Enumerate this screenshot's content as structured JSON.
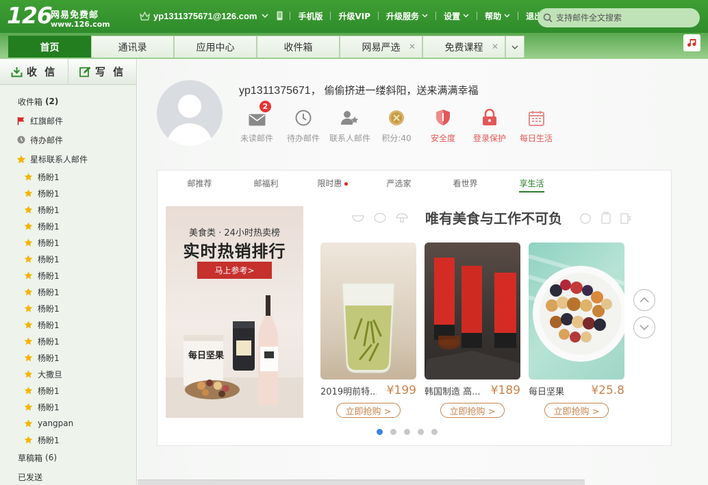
{
  "header": {
    "logo_number": "126",
    "logo_text": "网易免费邮",
    "logo_url": "www.126.com",
    "user_email": "yp1311375671@126.com",
    "nav": [
      "手机版",
      "升级VIP",
      "升级服务",
      "设置",
      "帮助",
      "退出"
    ],
    "search_placeholder": "支持邮件全文搜索"
  },
  "tabs": [
    {
      "label": "首页",
      "active": true,
      "closable": false
    },
    {
      "label": "通讯录",
      "active": false,
      "closable": false
    },
    {
      "label": "应用中心",
      "active": false,
      "closable": false
    },
    {
      "label": "收件箱",
      "active": false,
      "closable": false
    },
    {
      "label": "网易严选",
      "active": false,
      "closable": true
    },
    {
      "label": "免费课程",
      "active": false,
      "closable": true
    }
  ],
  "sidebar": {
    "receive_label": "收 信",
    "write_label": "写 信",
    "inbox": {
      "label": "收件箱",
      "count": "(2)"
    },
    "red_flag": "红旗邮件",
    "todo": "待办邮件",
    "starred": "星标联系人邮件",
    "contacts": [
      "杨盼1",
      "杨盼1",
      "杨盼1",
      "杨盼1",
      "杨盼1",
      "杨盼1",
      "杨盼1",
      "杨盼1",
      "杨盼1",
      "杨盼1",
      "杨盼1",
      "杨盼1",
      "大撒旦",
      "杨盼1",
      "杨盼1",
      "yangpan",
      "杨盼1"
    ],
    "drafts": {
      "label": "草稿箱",
      "count": "(6)"
    },
    "sent": "已发送"
  },
  "profile": {
    "username": "yp1311375671",
    "greeting": "， 偷偷挤进一缕斜阳，送来满满幸福",
    "stats": [
      {
        "icon": "mail-icon",
        "label": "未读邮件",
        "badge": "2",
        "accent": false
      },
      {
        "icon": "clock-icon",
        "label": "待办邮件",
        "badge": "",
        "accent": false
      },
      {
        "icon": "contact-star-icon",
        "label": "联系人邮件",
        "badge": "",
        "accent": false
      },
      {
        "icon": "coin-icon",
        "label": "积分:40",
        "badge": "",
        "accent": false
      },
      {
        "icon": "shield-icon",
        "label": "安全度",
        "badge": "",
        "accent": true
      },
      {
        "icon": "lock-icon",
        "label": "登录保护",
        "badge": "",
        "accent": true
      },
      {
        "icon": "calendar-icon",
        "label": "每日生活",
        "badge": "",
        "accent": true
      }
    ]
  },
  "content_tabs": [
    {
      "label": "邮推荐",
      "active": false,
      "dot": false
    },
    {
      "label": "邮福利",
      "active": false,
      "dot": false
    },
    {
      "label": "限时惠",
      "active": false,
      "dot": true
    },
    {
      "label": "严选家",
      "active": false,
      "dot": false
    },
    {
      "label": "看世界",
      "active": false,
      "dot": false
    },
    {
      "label": "享生活",
      "active": true,
      "dot": false
    }
  ],
  "banner": {
    "subtitle": "美食类 · 24小时热卖榜",
    "title": "实时热销排行",
    "button": "马上参考>"
  },
  "section_title": "唯有美食与工作不可负",
  "products": [
    {
      "name": "2019明前特...",
      "price": "¥199",
      "buy": "立即抢购 >"
    },
    {
      "name": "韩国制造 高...",
      "price": "¥189",
      "buy": "立即抢购 >"
    },
    {
      "name": "每日坚果",
      "price": "¥25.8",
      "buy": "立即抢购 >"
    }
  ],
  "carousel": {
    "pages": 5,
    "current": 1
  },
  "colors": {
    "brand_green": "#2f8c2b",
    "active_tab": "#237e1f",
    "price": "#c9824a",
    "accent_red": "#e45757",
    "dot_active": "#3b83e4"
  }
}
